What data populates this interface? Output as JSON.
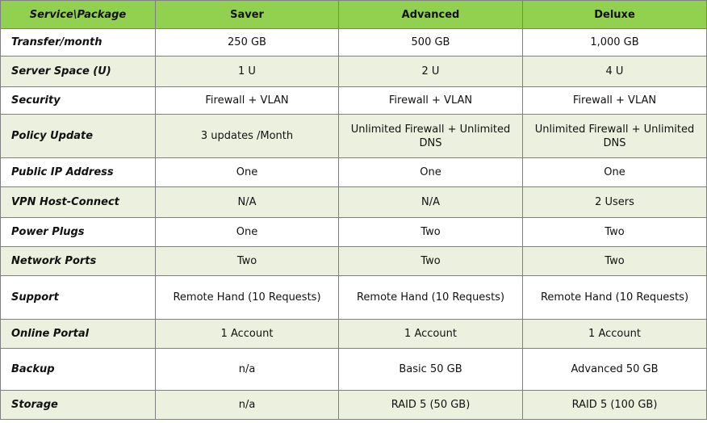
{
  "table": {
    "header": {
      "corner": "Service\\Package",
      "columns": [
        "Saver",
        "Advanced",
        "Deluxe"
      ]
    },
    "rows": [
      {
        "label": "Transfer/month",
        "values": [
          "250 GB",
          "500 GB",
          "1,000 GB"
        ]
      },
      {
        "label": "Server Space (U)",
        "values": [
          "1 U",
          "2 U",
          "4 U"
        ]
      },
      {
        "label": "Security",
        "values": [
          "Firewall + VLAN",
          "Firewall + VLAN",
          "Firewall + VLAN"
        ]
      },
      {
        "label": "Policy Update",
        "values": [
          "3 updates /Month",
          "Unlimited Firewall + Unlimited DNS",
          "Unlimited Firewall + Unlimited DNS"
        ]
      },
      {
        "label": "Public IP Address",
        "values": [
          "One",
          "One",
          "One"
        ]
      },
      {
        "label": "VPN Host-Connect",
        "values": [
          "N/A",
          "N/A",
          "2 Users"
        ]
      },
      {
        "label": "Power Plugs",
        "values": [
          "One",
          "Two",
          "Two"
        ]
      },
      {
        "label": "Network Ports",
        "values": [
          "Two",
          "Two",
          "Two"
        ]
      },
      {
        "label": "Support",
        "values": [
          "Remote Hand (10 Requests)",
          "Remote Hand (10 Requests)",
          "Remote Hand (10 Requests)"
        ]
      },
      {
        "label": "Online Portal",
        "values": [
          "1 Account",
          "1 Account",
          "1 Account"
        ]
      },
      {
        "label": "Backup",
        "values": [
          "n/a",
          "Basic 50 GB",
          "Advanced 50 GB"
        ]
      },
      {
        "label": "Storage",
        "values": [
          "n/a",
          "RAID 5 (50 GB)",
          "RAID 5 (100 GB)"
        ]
      }
    ]
  },
  "colors": {
    "header_bg": "#92d050",
    "even_row_bg": "#ebf1de",
    "odd_row_bg": "#ffffff",
    "border": "#7f7f7f"
  }
}
